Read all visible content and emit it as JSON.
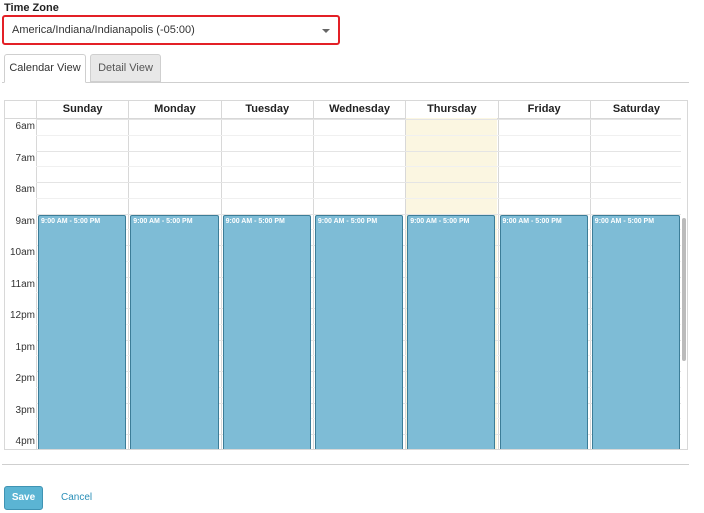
{
  "timezone": {
    "label": "Time Zone",
    "value": "America/Indiana/Indianapolis (-05:00)"
  },
  "tabs": [
    {
      "label": "Calendar View",
      "active": true
    },
    {
      "label": "Detail View",
      "active": false
    }
  ],
  "calendar": {
    "days": [
      "Sunday",
      "Monday",
      "Tuesday",
      "Wednesday",
      "Thursday",
      "Friday",
      "Saturday"
    ],
    "today_index": 4,
    "hours": [
      "6am",
      "7am",
      "8am",
      "9am",
      "10am",
      "11am",
      "12pm",
      "1pm",
      "2pm",
      "3pm",
      "4pm"
    ],
    "event_label": "9:00 AM - 5:00 PM",
    "event_start_hour": 9,
    "event_color": "#7ebcd6",
    "today_color": "#fbf6e1"
  },
  "actions": {
    "save_label": "Save",
    "cancel_label": "Cancel"
  }
}
